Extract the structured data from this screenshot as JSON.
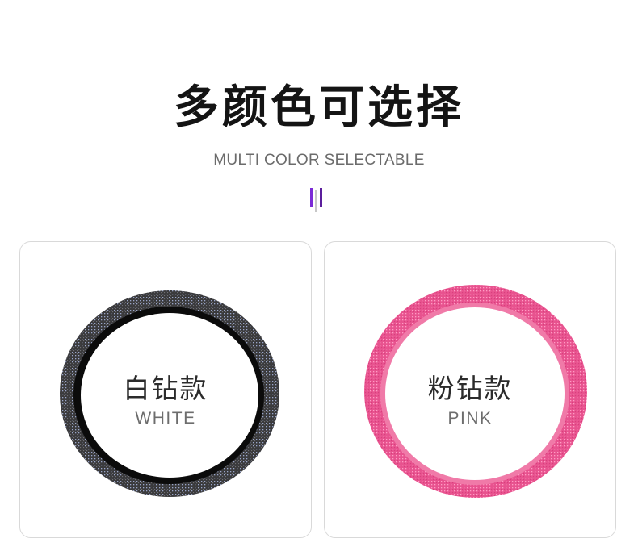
{
  "header": {
    "title": "多颜色可选择",
    "subtitle": "MULTI COLOR SELECTABLE",
    "accent_colors": [
      "#7b2bd6",
      "#bdbdbd",
      "#5b1e9c"
    ]
  },
  "variants": [
    {
      "label_zh": "白钻款",
      "label_en": "WHITE",
      "ring_color": "#3a3a3c",
      "ring_inner_color": "#0b0b0b",
      "sparkle_color": "#9aa6c9"
    },
    {
      "label_zh": "粉钻款",
      "label_en": "PINK",
      "ring_color": "#e8538f",
      "ring_inner_color": "#f07aa8",
      "sparkle_color": "#ff9cc4"
    }
  ]
}
